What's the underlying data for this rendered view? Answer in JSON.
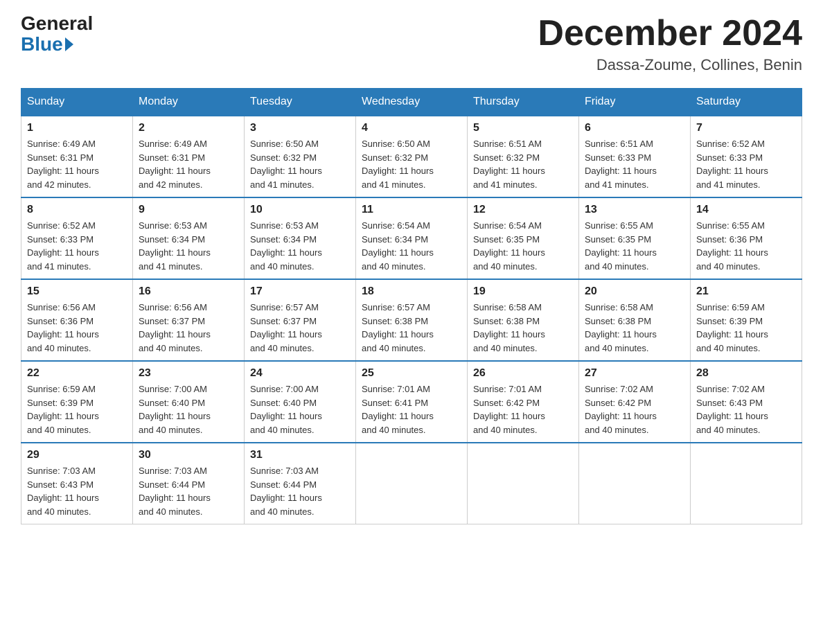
{
  "header": {
    "logo_general": "General",
    "logo_blue": "Blue",
    "month_title": "December 2024",
    "location": "Dassa-Zoume, Collines, Benin"
  },
  "weekdays": [
    "Sunday",
    "Monday",
    "Tuesday",
    "Wednesday",
    "Thursday",
    "Friday",
    "Saturday"
  ],
  "weeks": [
    [
      {
        "day": "1",
        "sunrise": "6:49 AM",
        "sunset": "6:31 PM",
        "daylight": "11 hours and 42 minutes."
      },
      {
        "day": "2",
        "sunrise": "6:49 AM",
        "sunset": "6:31 PM",
        "daylight": "11 hours and 42 minutes."
      },
      {
        "day": "3",
        "sunrise": "6:50 AM",
        "sunset": "6:32 PM",
        "daylight": "11 hours and 41 minutes."
      },
      {
        "day": "4",
        "sunrise": "6:50 AM",
        "sunset": "6:32 PM",
        "daylight": "11 hours and 41 minutes."
      },
      {
        "day": "5",
        "sunrise": "6:51 AM",
        "sunset": "6:32 PM",
        "daylight": "11 hours and 41 minutes."
      },
      {
        "day": "6",
        "sunrise": "6:51 AM",
        "sunset": "6:33 PM",
        "daylight": "11 hours and 41 minutes."
      },
      {
        "day": "7",
        "sunrise": "6:52 AM",
        "sunset": "6:33 PM",
        "daylight": "11 hours and 41 minutes."
      }
    ],
    [
      {
        "day": "8",
        "sunrise": "6:52 AM",
        "sunset": "6:33 PM",
        "daylight": "11 hours and 41 minutes."
      },
      {
        "day": "9",
        "sunrise": "6:53 AM",
        "sunset": "6:34 PM",
        "daylight": "11 hours and 41 minutes."
      },
      {
        "day": "10",
        "sunrise": "6:53 AM",
        "sunset": "6:34 PM",
        "daylight": "11 hours and 40 minutes."
      },
      {
        "day": "11",
        "sunrise": "6:54 AM",
        "sunset": "6:34 PM",
        "daylight": "11 hours and 40 minutes."
      },
      {
        "day": "12",
        "sunrise": "6:54 AM",
        "sunset": "6:35 PM",
        "daylight": "11 hours and 40 minutes."
      },
      {
        "day": "13",
        "sunrise": "6:55 AM",
        "sunset": "6:35 PM",
        "daylight": "11 hours and 40 minutes."
      },
      {
        "day": "14",
        "sunrise": "6:55 AM",
        "sunset": "6:36 PM",
        "daylight": "11 hours and 40 minutes."
      }
    ],
    [
      {
        "day": "15",
        "sunrise": "6:56 AM",
        "sunset": "6:36 PM",
        "daylight": "11 hours and 40 minutes."
      },
      {
        "day": "16",
        "sunrise": "6:56 AM",
        "sunset": "6:37 PM",
        "daylight": "11 hours and 40 minutes."
      },
      {
        "day": "17",
        "sunrise": "6:57 AM",
        "sunset": "6:37 PM",
        "daylight": "11 hours and 40 minutes."
      },
      {
        "day": "18",
        "sunrise": "6:57 AM",
        "sunset": "6:38 PM",
        "daylight": "11 hours and 40 minutes."
      },
      {
        "day": "19",
        "sunrise": "6:58 AM",
        "sunset": "6:38 PM",
        "daylight": "11 hours and 40 minutes."
      },
      {
        "day": "20",
        "sunrise": "6:58 AM",
        "sunset": "6:38 PM",
        "daylight": "11 hours and 40 minutes."
      },
      {
        "day": "21",
        "sunrise": "6:59 AM",
        "sunset": "6:39 PM",
        "daylight": "11 hours and 40 minutes."
      }
    ],
    [
      {
        "day": "22",
        "sunrise": "6:59 AM",
        "sunset": "6:39 PM",
        "daylight": "11 hours and 40 minutes."
      },
      {
        "day": "23",
        "sunrise": "7:00 AM",
        "sunset": "6:40 PM",
        "daylight": "11 hours and 40 minutes."
      },
      {
        "day": "24",
        "sunrise": "7:00 AM",
        "sunset": "6:40 PM",
        "daylight": "11 hours and 40 minutes."
      },
      {
        "day": "25",
        "sunrise": "7:01 AM",
        "sunset": "6:41 PM",
        "daylight": "11 hours and 40 minutes."
      },
      {
        "day": "26",
        "sunrise": "7:01 AM",
        "sunset": "6:42 PM",
        "daylight": "11 hours and 40 minutes."
      },
      {
        "day": "27",
        "sunrise": "7:02 AM",
        "sunset": "6:42 PM",
        "daylight": "11 hours and 40 minutes."
      },
      {
        "day": "28",
        "sunrise": "7:02 AM",
        "sunset": "6:43 PM",
        "daylight": "11 hours and 40 minutes."
      }
    ],
    [
      {
        "day": "29",
        "sunrise": "7:03 AM",
        "sunset": "6:43 PM",
        "daylight": "11 hours and 40 minutes."
      },
      {
        "day": "30",
        "sunrise": "7:03 AM",
        "sunset": "6:44 PM",
        "daylight": "11 hours and 40 minutes."
      },
      {
        "day": "31",
        "sunrise": "7:03 AM",
        "sunset": "6:44 PM",
        "daylight": "11 hours and 40 minutes."
      },
      null,
      null,
      null,
      null
    ]
  ],
  "labels": {
    "sunrise": "Sunrise: ",
    "sunset": "Sunset: ",
    "daylight": "Daylight: "
  }
}
